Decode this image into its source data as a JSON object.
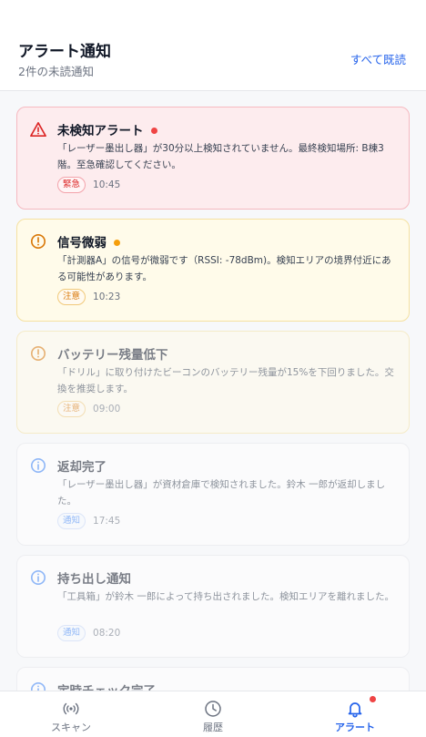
{
  "header": {
    "title": "アラート通知",
    "subtitle": "2件の未読通知",
    "mark_all_read": "すべて既読"
  },
  "alerts": [
    {
      "title": "未検知アラート",
      "message": "「レーザー墨出し器」が30分以上検知されていません。最終検知場所: B棟3階。至急確認してください。",
      "badge": "緊急",
      "time": "10:45",
      "level": "urgent",
      "unread": true,
      "icon": "warning-triangle-icon"
    },
    {
      "title": "信号微弱",
      "message": "「計測器A」の信号が微弱です（RSSI: -78dBm)。検知エリアの境界付近にある可能性があります。",
      "badge": "注意",
      "time": "10:23",
      "level": "warn",
      "unread": true,
      "icon": "warning-circle-icon"
    },
    {
      "title": "バッテリー残量低下",
      "message": "「ドリル」に取り付けたビーコンのバッテリー残量が15%を下回りました。交換を推奨します。",
      "badge": "注意",
      "time": "09:00",
      "level": "warn",
      "unread": false,
      "icon": "warning-circle-icon"
    },
    {
      "title": "返却完了",
      "message": "「レーザー墨出し器」が資材倉庫で検知されました。鈴木 一郎が返却しました。",
      "badge": "通知",
      "time": "17:45",
      "level": "info",
      "unread": false,
      "icon": "info-circle-icon"
    },
    {
      "title": "持ち出し通知",
      "message": "「工具箱」が鈴木 一郎によって持ち出されました。検知エリアを離れました。",
      "badge": "通知",
      "time": "08:20",
      "level": "info",
      "unread": false,
      "icon": "info-circle-icon"
    },
    {
      "title": "定時チェック完了",
      "message": "",
      "badge": "",
      "time": "",
      "level": "info",
      "unread": false,
      "icon": "info-circle-icon"
    }
  ],
  "nav": {
    "scan": "スキャン",
    "history": "履歴",
    "alerts": "アラート"
  },
  "colors": {
    "accent": "#2563eb",
    "urgent": "#dc2626",
    "warn": "#d97706",
    "info": "#3b82f6"
  }
}
